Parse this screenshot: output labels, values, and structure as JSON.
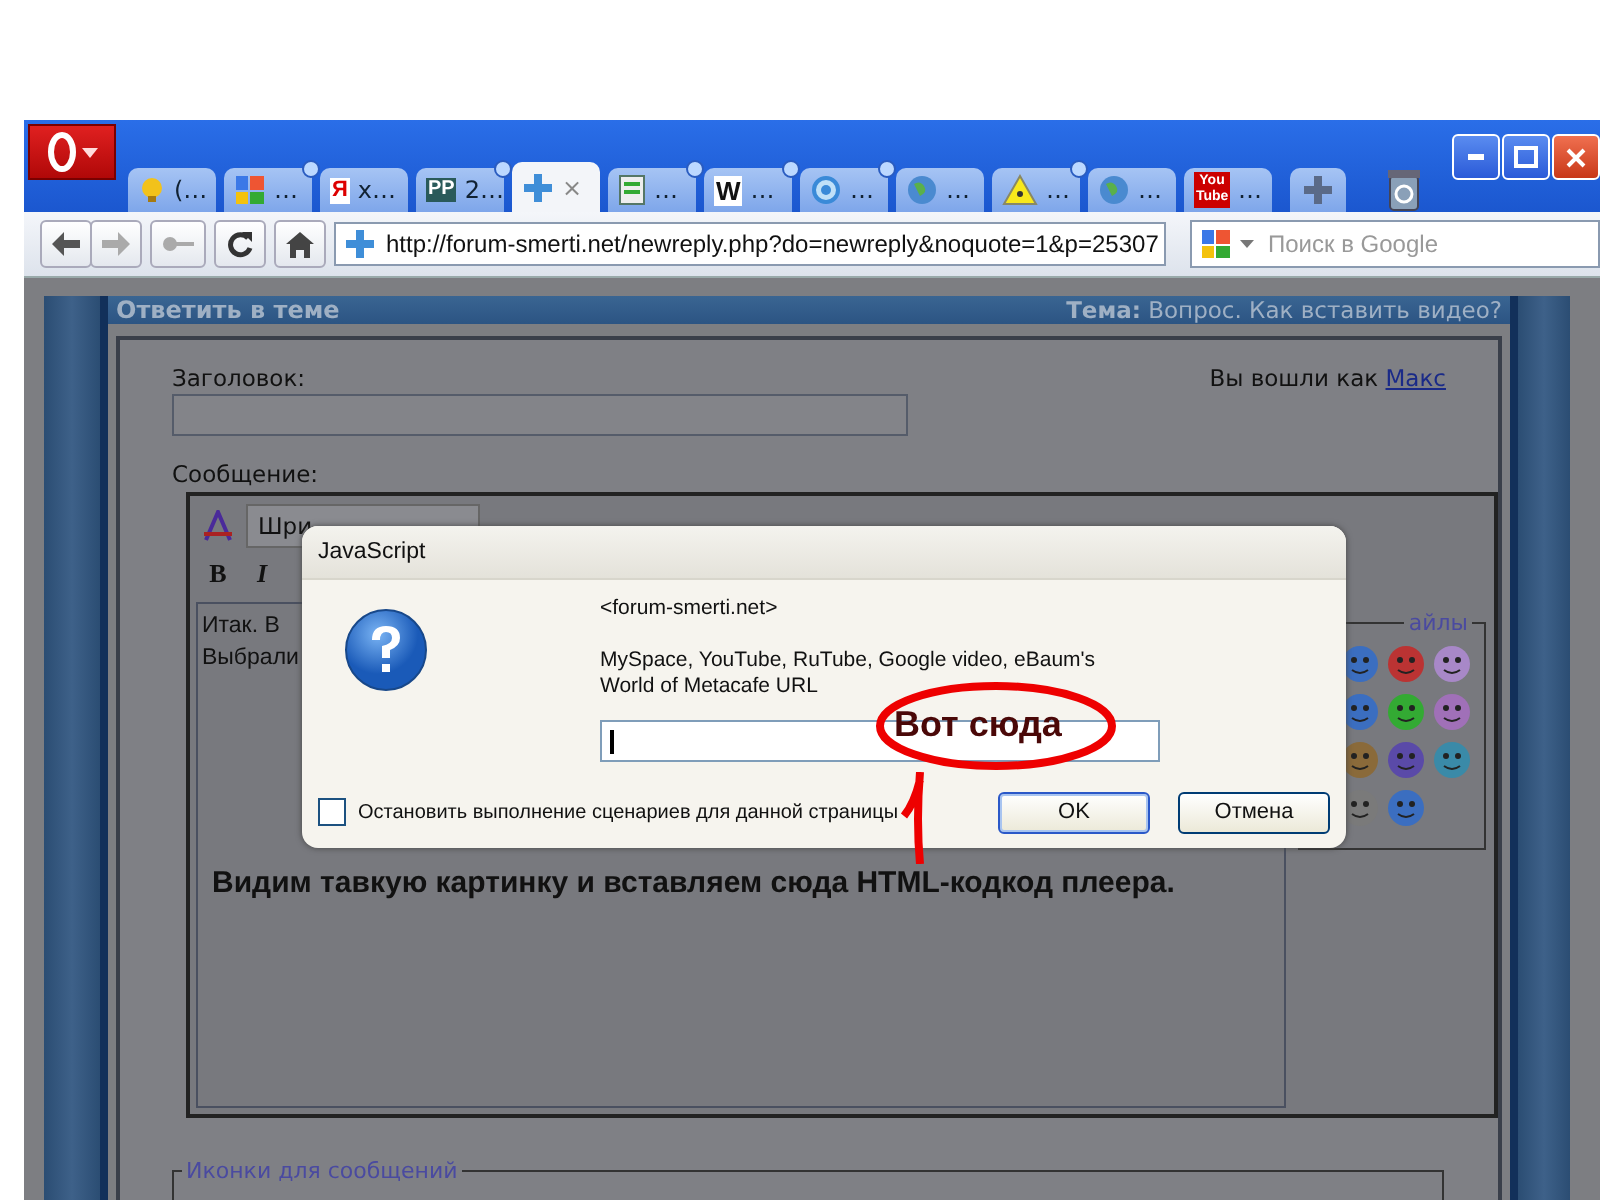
{
  "tabs": [
    {
      "kind": "bulb",
      "label": "(…",
      "dot": false,
      "selected": false
    },
    {
      "kind": "google",
      "label": "…",
      "dot": true,
      "selected": false
    },
    {
      "kind": "yandex",
      "label": "х…",
      "badge": "Я",
      "dot": false,
      "selected": false
    },
    {
      "kind": "pp",
      "label": "2…",
      "badge": "PP",
      "dot": true,
      "selected": false
    },
    {
      "kind": "cross",
      "label": "×",
      "dot": false,
      "selected": true
    },
    {
      "kind": "page",
      "label": "…",
      "dot": true,
      "selected": false
    },
    {
      "kind": "wiki",
      "label": "…",
      "badge": "W",
      "dot": true,
      "selected": false
    },
    {
      "kind": "ring",
      "label": "…",
      "dot": true,
      "selected": false
    },
    {
      "kind": "globe",
      "label": "…",
      "dot": false,
      "selected": false
    },
    {
      "kind": "warning",
      "label": "…",
      "dot": true,
      "selected": false
    },
    {
      "kind": "globe",
      "label": "…",
      "dot": false,
      "selected": false
    },
    {
      "kind": "youtube",
      "label": "…",
      "badge": "You Tube",
      "dot": false,
      "selected": false
    }
  ],
  "toolbar": {
    "address": "http://forum-smerti.net/newreply.php?do=newreply&noquote=1&p=25307",
    "search_placeholder": "Поиск в Google"
  },
  "page": {
    "header_title": "Ответить в теме",
    "topic_label": "Тема:",
    "topic": "Вопрос. Как вставить видео?",
    "subject_label": "Заголовок:",
    "logged_in": "Вы вошли как",
    "user": "Макс",
    "message_label": "Сообщение:",
    "font_select": "Шри",
    "format_buttons": [
      "B",
      "I"
    ],
    "text_lines": [
      "Итак. В",
      "Выбрали"
    ],
    "caption": "Видим тавкую картинку и вставляем сюда HTML-кодкод плеера.",
    "smilies_legend": "айлы",
    "icons_legend": "Иконки для сообщений"
  },
  "dialog": {
    "title": "JavaScript",
    "origin": "<forum-smerti.net>",
    "message": "MySpace, YouTube, RuTube, Google video, eBaum's World of Metacafe URL",
    "checkbox": {
      "label": "Остановить выполнение сценариев для данной страницы",
      "checked": false
    },
    "buttons": [
      {
        "label": "OK",
        "default": true
      },
      {
        "label": "Отмена",
        "default": false
      }
    ]
  },
  "annotation": {
    "callout": "Вот сюда"
  }
}
